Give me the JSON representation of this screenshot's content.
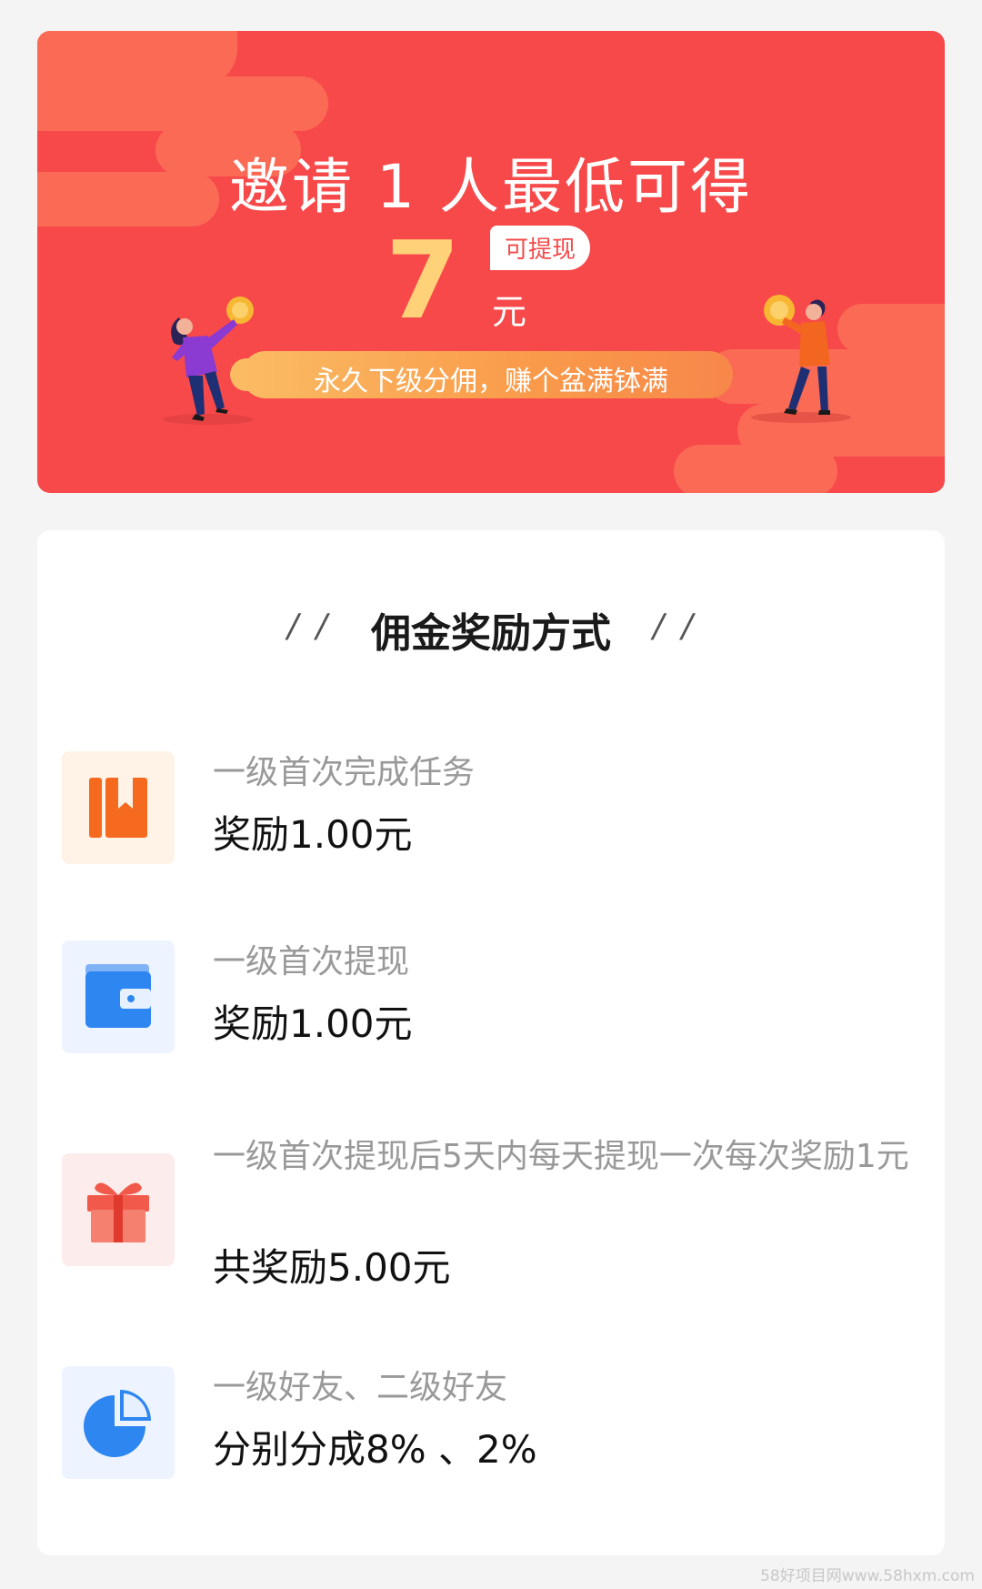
{
  "banner": {
    "title": "邀请 1 人最低可得",
    "amount": "7",
    "withdraw_tag": "可提现",
    "unit": "元",
    "slogan": "永久下级分佣，赚个盆满钵满"
  },
  "section": {
    "title": "佣金奖励方式",
    "quote_left": "/ /",
    "quote_right": "/ /"
  },
  "rewards": [
    {
      "icon": "book-icon",
      "label": "一级首次完成任务",
      "value": "奖励1.00元"
    },
    {
      "icon": "wallet-icon",
      "label": "一级首次提现",
      "value": "奖励1.00元"
    },
    {
      "icon": "gift-icon",
      "label": "一级首次提现后5天内每天提现一次每次奖励1元",
      "value": "共奖励5.00元"
    },
    {
      "icon": "pie-chart-icon",
      "label": "一级好友、二级好友",
      "value": "分别分成8% 、2%"
    }
  ],
  "colors": {
    "banner_bg": "#f7494a",
    "amount": "#ffd27a",
    "book_icon": "#f56a1f",
    "wallet_icon": "#2e86f0",
    "gift_icon": "#f15a4a",
    "pie_icon": "#2e86f0"
  },
  "watermark": "58好项目网www.58hxm.com"
}
